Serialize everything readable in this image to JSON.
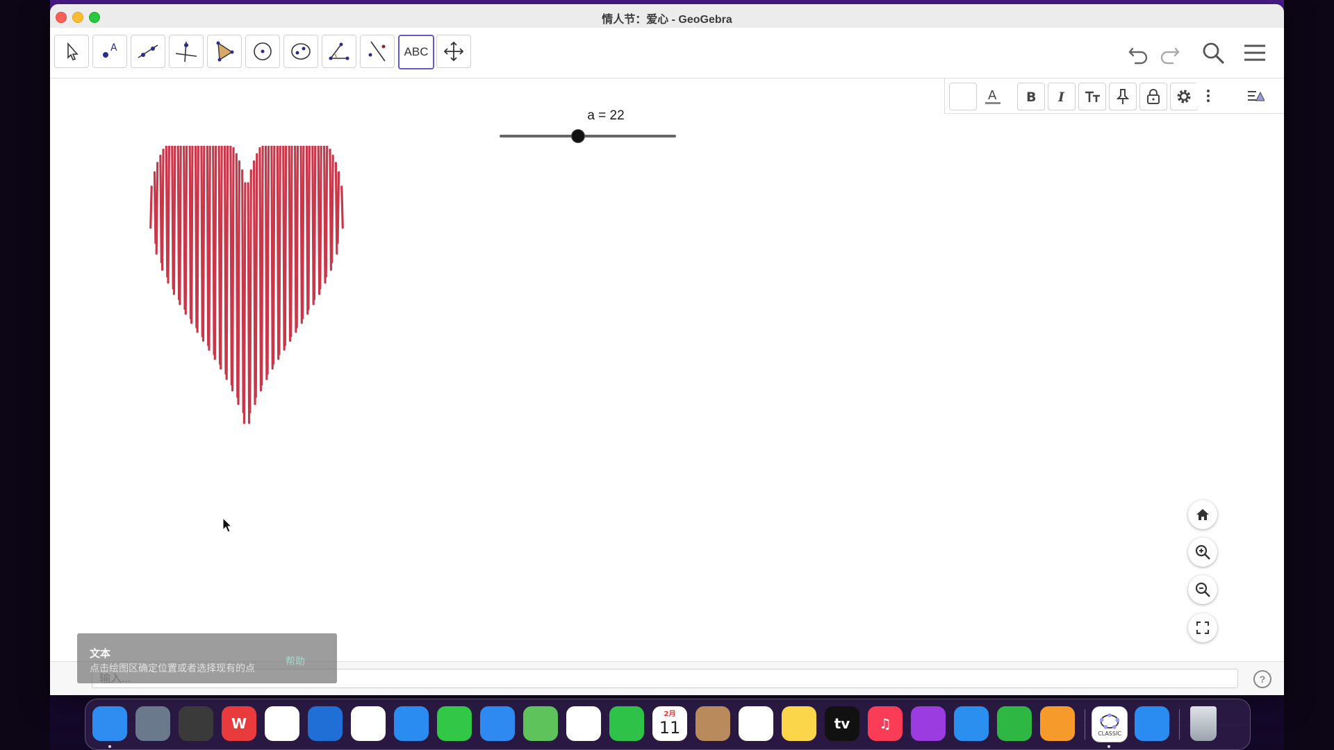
{
  "window": {
    "title": "情人节：爱心 - GeoGebra"
  },
  "toolbar": {
    "tools": [
      {
        "name": "move-tool",
        "icon": "arrow-pointer-icon"
      },
      {
        "name": "point-tool",
        "icon": "point-icon"
      },
      {
        "name": "line-tool",
        "icon": "line-icon"
      },
      {
        "name": "perpendicular-tool",
        "icon": "perpendicular-icon"
      },
      {
        "name": "polygon-tool",
        "icon": "polygon-icon"
      },
      {
        "name": "circle-tool",
        "icon": "circle-icon"
      },
      {
        "name": "conic-tool",
        "icon": "ellipse-icon"
      },
      {
        "name": "angle-tool",
        "icon": "angle-icon"
      },
      {
        "name": "reflect-tool",
        "icon": "reflect-icon"
      },
      {
        "name": "text-tool",
        "icon": "text-icon",
        "label": "ABC",
        "selected": true
      },
      {
        "name": "move-graphics-tool",
        "icon": "move-arrows-icon"
      }
    ]
  },
  "slider": {
    "label": "a = 22",
    "value": 22,
    "min": 0,
    "max": 50
  },
  "heart": {
    "color": "#c8374a",
    "lines": 66
  },
  "tooltip": {
    "title": "文本",
    "description": "点击绘图区确定位置或者选择现有的点",
    "help": "帮助"
  },
  "input_bar": {
    "placeholder": "输入...",
    "help": "?"
  },
  "dock": {
    "apps": [
      {
        "name": "finder",
        "bg": "#2f8cf0"
      },
      {
        "name": "launchpad",
        "bg": "#6a7a8c"
      },
      {
        "name": "screenshot",
        "bg": "#3a3a3a"
      },
      {
        "name": "wps",
        "bg": "#e93b3b",
        "glyph": "W"
      },
      {
        "name": "baidu-netdisk",
        "bg": "#ffffff"
      },
      {
        "name": "onedrive",
        "bg": "#1f6fd6"
      },
      {
        "name": "chrome",
        "bg": "#ffffff"
      },
      {
        "name": "safari",
        "bg": "#2a8cf0"
      },
      {
        "name": "messages",
        "bg": "#33c748"
      },
      {
        "name": "mail",
        "bg": "#2e8af0"
      },
      {
        "name": "maps",
        "bg": "#5fc35b"
      },
      {
        "name": "photos",
        "bg": "#ffffff"
      },
      {
        "name": "facetime",
        "bg": "#2fc248"
      },
      {
        "name": "calendar",
        "bg": "#ffffff",
        "month": "2月",
        "day": "11"
      },
      {
        "name": "contacts",
        "bg": "#b98a5b"
      },
      {
        "name": "reminders",
        "bg": "#ffffff"
      },
      {
        "name": "notes",
        "bg": "#fbd64b"
      },
      {
        "name": "apple-tv",
        "bg": "#111111",
        "glyph": "tv"
      },
      {
        "name": "music",
        "bg": "#fa3c56",
        "glyph": "♫"
      },
      {
        "name": "podcasts",
        "bg": "#9b3ce0"
      },
      {
        "name": "keynote",
        "bg": "#2b8ff0"
      },
      {
        "name": "numbers",
        "bg": "#2fb744"
      },
      {
        "name": "pages",
        "bg": "#f59a2b"
      },
      {
        "name": "geogebra-classic",
        "bg": "#ffffff",
        "label": "CLASSIC"
      },
      {
        "name": "app-store",
        "bg": "#2a8cf0"
      },
      {
        "name": "trash",
        "bg": "transparent"
      }
    ]
  }
}
